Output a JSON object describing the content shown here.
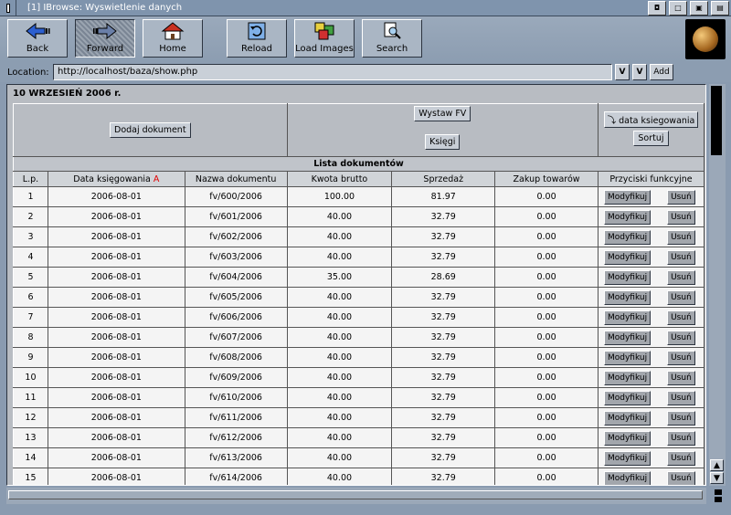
{
  "window": {
    "title": "[1] IBrowse: Wyswietlenie danych"
  },
  "toolbar": {
    "back": "Back",
    "forward": "Forward",
    "home": "Home",
    "reload": "Reload",
    "load_images": "Load Images",
    "search": "Search"
  },
  "location": {
    "label": "Location:",
    "url": "http://localhost/baza/show.php",
    "add": "Add"
  },
  "page": {
    "date_heading": "10 WRZESIEŃ 2006 r.",
    "add_document": "Dodaj dokument",
    "issue_invoice": "Wystaw FV",
    "books": "Księgi",
    "sort_field": "data ksiegowania",
    "sort": "Sortuj",
    "list_caption": "Lista dokumentów",
    "columns": [
      "L.p.",
      "Data księgowania",
      "Nazwa dokumentu",
      "Kwota brutto",
      "Sprzedaż",
      "Zakup towarów",
      "Przyciski funkcyjne"
    ],
    "sort_marker": "A",
    "modify": "Modyfikuj",
    "delete": "Usuń",
    "rows": [
      [
        "1",
        "2006-08-01",
        "fv/600/2006",
        "100.00",
        "81.97",
        "0.00"
      ],
      [
        "2",
        "2006-08-01",
        "fv/601/2006",
        "40.00",
        "32.79",
        "0.00"
      ],
      [
        "3",
        "2006-08-01",
        "fv/602/2006",
        "40.00",
        "32.79",
        "0.00"
      ],
      [
        "4",
        "2006-08-01",
        "fv/603/2006",
        "40.00",
        "32.79",
        "0.00"
      ],
      [
        "5",
        "2006-08-01",
        "fv/604/2006",
        "35.00",
        "28.69",
        "0.00"
      ],
      [
        "6",
        "2006-08-01",
        "fv/605/2006",
        "40.00",
        "32.79",
        "0.00"
      ],
      [
        "7",
        "2006-08-01",
        "fv/606/2006",
        "40.00",
        "32.79",
        "0.00"
      ],
      [
        "8",
        "2006-08-01",
        "fv/607/2006",
        "40.00",
        "32.79",
        "0.00"
      ],
      [
        "9",
        "2006-08-01",
        "fv/608/2006",
        "40.00",
        "32.79",
        "0.00"
      ],
      [
        "10",
        "2006-08-01",
        "fv/609/2006",
        "40.00",
        "32.79",
        "0.00"
      ],
      [
        "11",
        "2006-08-01",
        "fv/610/2006",
        "40.00",
        "32.79",
        "0.00"
      ],
      [
        "12",
        "2006-08-01",
        "fv/611/2006",
        "40.00",
        "32.79",
        "0.00"
      ],
      [
        "13",
        "2006-08-01",
        "fv/612/2006",
        "40.00",
        "32.79",
        "0.00"
      ],
      [
        "14",
        "2006-08-01",
        "fv/613/2006",
        "40.00",
        "32.79",
        "0.00"
      ],
      [
        "15",
        "2006-08-01",
        "fv/614/2006",
        "40.00",
        "32.79",
        "0.00"
      ]
    ]
  },
  "icons": {
    "back": "arrow-left-icon",
    "forward": "arrow-right-icon",
    "home": "house-icon",
    "reload": "reload-icon",
    "load_images": "images-icon",
    "search": "magnifier-icon"
  },
  "colors": {
    "window_bg": "#8a9bb0",
    "content_bg": "#b8bcc2",
    "row_bg": "#f4f4f4",
    "sort_marker": "#e00000"
  }
}
